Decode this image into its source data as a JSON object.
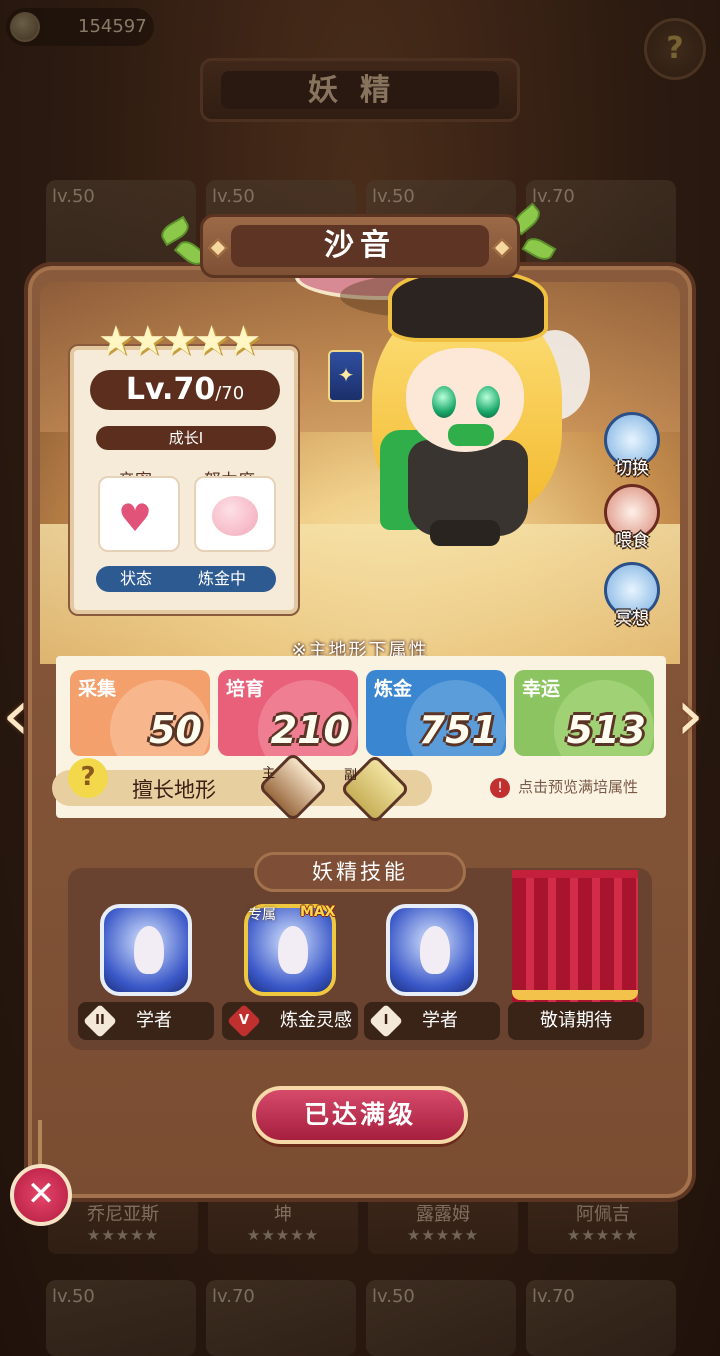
{
  "currency": {
    "value": "154597"
  },
  "screen_title": "妖精",
  "background": {
    "card_levels": [
      "lv.50",
      "lv.50",
      "lv.50",
      "lv.70",
      "lv.50",
      "lv.70",
      "lv.50",
      "lv.70"
    ],
    "names": [
      "乔尼亚斯",
      "坤",
      "露露姆",
      "阿佩吉"
    ],
    "stars": "★★★★★"
  },
  "fairy": {
    "name": "沙音",
    "stars": "★★★★★",
    "level": "Lv.70",
    "level_max": "/70",
    "growth": "成长I",
    "intimacy_label": "亲密",
    "effort_label": "努力度",
    "status_label": "状态",
    "status_value": "炼金中"
  },
  "side_buttons": [
    {
      "label": "切换",
      "icon": "switch-icon"
    },
    {
      "label": "喂食",
      "icon": "meat-icon"
    },
    {
      "label": "冥想",
      "icon": "meditate-icon"
    }
  ],
  "attributes": {
    "title": "※主地形下属性",
    "items": [
      {
        "name": "采集",
        "value": "50",
        "color": "#f4a06c"
      },
      {
        "name": "培育",
        "value": "210",
        "color": "#e8607a"
      },
      {
        "name": "炼金",
        "value": "751",
        "color": "#3a86d0"
      },
      {
        "name": "幸运",
        "value": "513",
        "color": "#8cc462"
      }
    ],
    "terrain_label": "擅长地形",
    "main_label": "主",
    "sub_label": "副",
    "preview_hint": "点击预览满培属性"
  },
  "skills": {
    "title": "妖精技能",
    "exclusive_label": "专属",
    "max_label": "MAX",
    "items": [
      {
        "roman": "II",
        "name": "学者"
      },
      {
        "roman": "V",
        "name": "炼金灵感"
      },
      {
        "roman": "I",
        "name": "学者"
      },
      {
        "name": "敬请期待"
      }
    ]
  },
  "max_button": "已达满级",
  "icons": {
    "close": "close-icon",
    "help": "help-icon",
    "coin": "coin-icon"
  }
}
